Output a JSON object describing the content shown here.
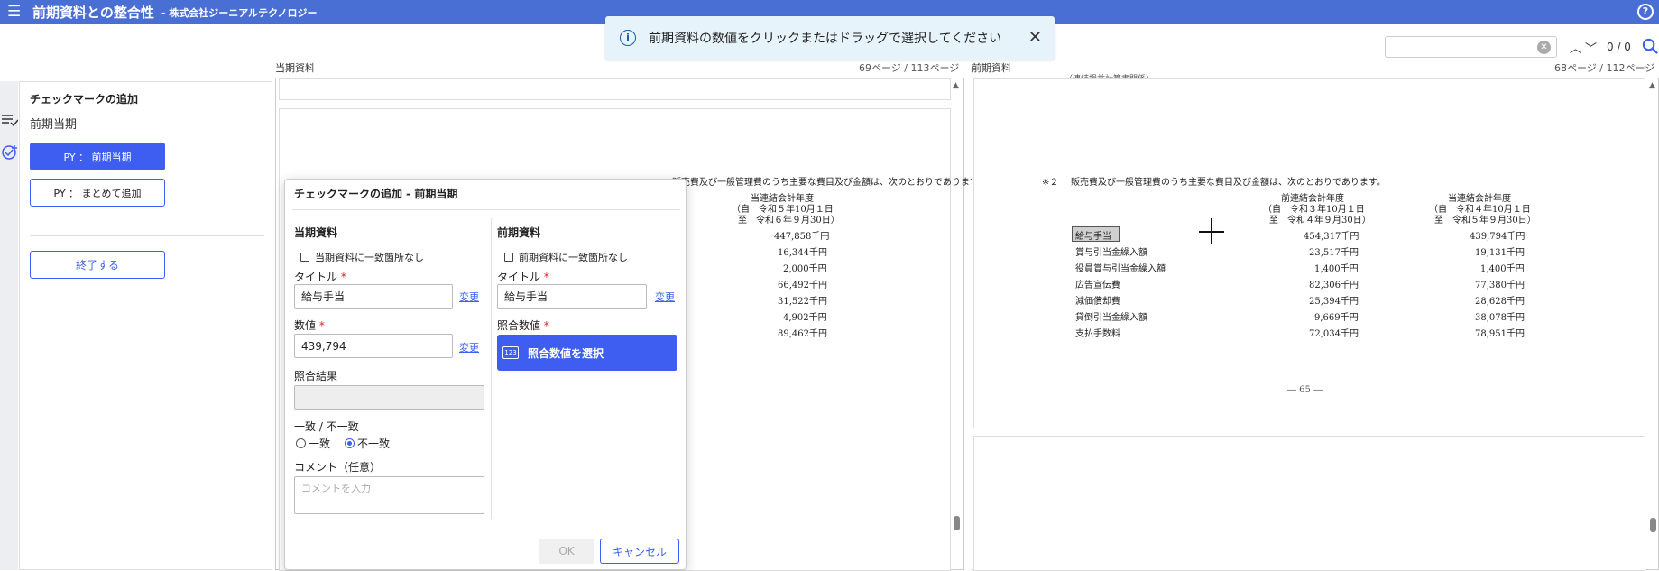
{
  "header": {
    "title": "前期資料との整合性",
    "company": "- 株式会社ジーニアルテクノロジー",
    "help_icon": "question-circle-icon",
    "menu_icon": "hamburger-menu-icon"
  },
  "toast": {
    "message": "前期資料の数値をクリックまたはドラッグで選択してください",
    "icon": "info-icon",
    "close_icon": "close-icon"
  },
  "search": {
    "value": "",
    "count": "0 / 0"
  },
  "sidepanel": {
    "title": "チェックマークの追加",
    "subtitle": "前期当期",
    "primary_button": "PY ： 前期当期",
    "secondary_button": "PY ： まとめて追加",
    "end_button": "終了する"
  },
  "current_doc": {
    "label": "当期資料",
    "page": "69ページ / 113ページ",
    "header_text": "当連結会計年度",
    "header_from": "（自　令和５年10月１日",
    "header_to": "至　令和６年９月30日）",
    "partial_top": "販売費及び一般管理費のうち主要な費目及び金額は、次のとおりであります。",
    "values": [
      "447,858千円",
      "16,344千円",
      "2,000千円",
      "66,492千円",
      "31,522千円",
      "4,902千円",
      "89,462千円"
    ]
  },
  "prior_doc": {
    "label": "前期資料",
    "page": "68ページ / 112ページ",
    "top_note": "（連結損益計算書関係）",
    "note_label": "※２",
    "note_text": "販売費及び一般管理費のうち主要な費目及び金額は、次のとおりであります。",
    "col1_header": "前連結会計年度",
    "col1_from": "（自　令和３年10月１日",
    "col1_to": "至　令和４年９月30日）",
    "col2_header": "当連結会計年度",
    "col2_from": "（自　令和４年10月１日",
    "col2_to": "至　令和５年９月30日）",
    "rows": [
      {
        "item": "給与手当",
        "prev": "454,317千円",
        "curr": "439,794千円"
      },
      {
        "item": "賞与引当金繰入額",
        "prev": "23,517千円",
        "curr": "19,131千円"
      },
      {
        "item": "役員賞与引当金繰入額",
        "prev": "1,400千円",
        "curr": "1,400千円"
      },
      {
        "item": "広告宣伝費",
        "prev": "82,306千円",
        "curr": "77,380千円"
      },
      {
        "item": "減価償却費",
        "prev": "25,394千円",
        "curr": "28,628千円"
      },
      {
        "item": "貸倒引当金繰入額",
        "prev": "9,669千円",
        "curr": "38,078千円"
      },
      {
        "item": "支払手数料",
        "prev": "72,034千円",
        "curr": "78,951千円"
      }
    ],
    "page_number": "― 65 ―"
  },
  "dialog": {
    "title": "チェックマークの追加 - 前期当期",
    "left": {
      "section": "当期資料",
      "no_match_label": "当期資料に一致箇所なし",
      "title_label": "タイトル",
      "title_value": "給与手当",
      "change_link": "変更",
      "value_label": "数値",
      "value_value": "439,794",
      "value_change_link": "変更",
      "result_label": "照合結果",
      "match_label": "一致 / 不一致",
      "radio_match": "一致",
      "radio_mismatch": "不一致",
      "comment_label": "コメント（任意）",
      "comment_placeholder": "コメントを入力"
    },
    "right": {
      "section": "前期資料",
      "no_match_label": "前期資料に一致箇所なし",
      "title_label": "タイトル",
      "title_value": "給与手当",
      "change_link": "変更",
      "compare_label": "照合数値",
      "select_button": "照合数値を選択",
      "select_icon_text": "123"
    },
    "required_mark": "*",
    "ok_button": "OK",
    "cancel_button": "キャンセル"
  }
}
